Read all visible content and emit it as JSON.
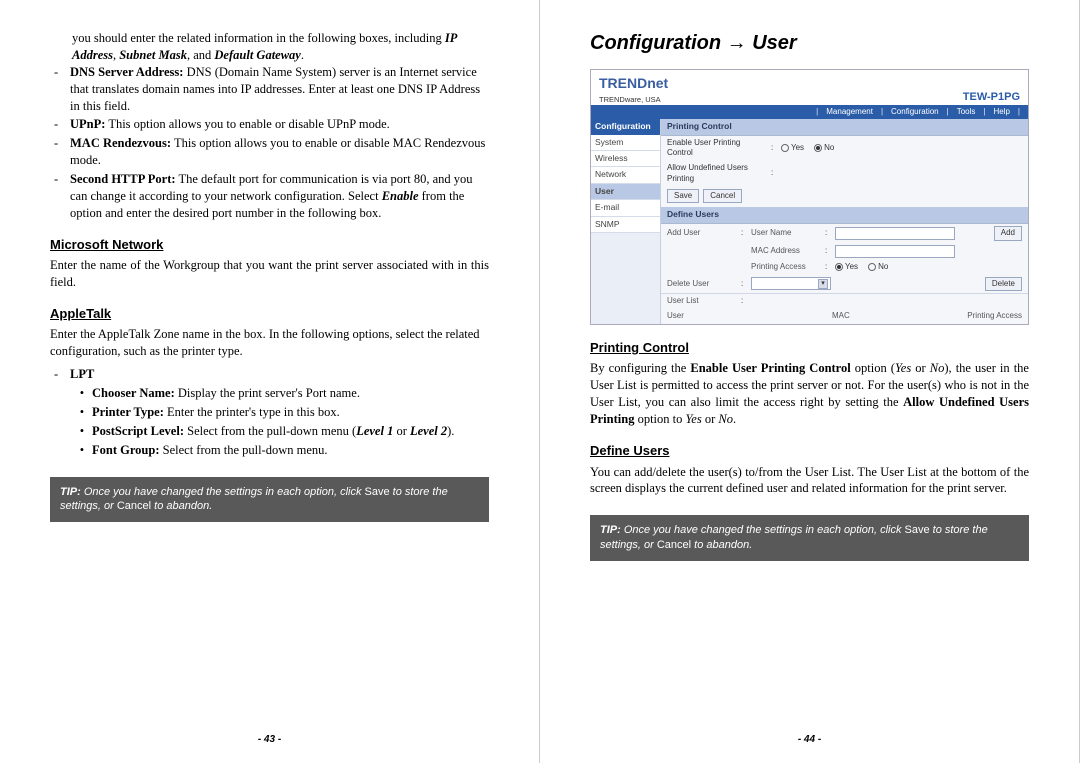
{
  "left": {
    "para_intro": "you should enter the related information in the following boxes, including ",
    "ip": "IP Address",
    "subnet": "Subnet Mask",
    "and": ", and ",
    "gateway": "Default Gateway",
    "dns_label": "DNS Server Address:",
    "dns_text": " DNS (Domain Name System) server is an Internet service that translates domain names into IP addresses. Enter at least one DNS IP Address in this field.",
    "upnp_label": "UPnP:",
    "upnp_text": " This option allows you to enable or disable UPnP mode.",
    "mac_label": "MAC Rendezvous:",
    "mac_text": " This option allows you to enable or disable MAC Rendezvous mode.",
    "http_label": "Second HTTP Port:",
    "http_text1": " The default port for communication is via port 80, and you can change it according to your network configuration.   Select ",
    "http_enable": "Enable",
    "http_text2": " from the option and enter the desired port number in the following box.",
    "sec_ms": "Microsoft Network",
    "ms_para": "Enter the name of the Workgroup that you want the print server associated with in this field.",
    "sec_at": "AppleTalk",
    "at_para": "Enter the AppleTalk Zone name in the box.   In the following options, select the related configuration, such as the printer type.",
    "lpt": "LPT",
    "chooser_label": "Chooser Name:",
    "chooser_text": " Display the print server's Port name.",
    "ptype_label": "Printer Type:",
    "ptype_text": " Enter the printer's type in this box.",
    "ps_label": "PostScript Level:",
    "ps_text1": " Select from the pull-down menu (",
    "ps_l1": "Level 1",
    "ps_or": " or ",
    "ps_l2": "Level 2",
    "ps_text2": ").",
    "font_label": "Font Group:",
    "font_text": " Select from the pull-down menu.",
    "tip_pre": "TIP:",
    "tip_mid": " Once you have changed the settings in each option, click ",
    "tip_save": "Save",
    "tip_mid2": " to store the settings, or ",
    "tip_cancel": "Cancel",
    "tip_end": " to abandon.",
    "pagenum": "- 43 -"
  },
  "right": {
    "title_a": "Configuration ",
    "title_b": " User",
    "sec_pc": "Printing Control",
    "pc_p1a": "By configuring the ",
    "pc_p1_enable": "Enable User Printing Control",
    "pc_p1b": " option (",
    "yes": "Yes",
    "or": " or ",
    "no": "No",
    "pc_p1c": "), the user in the User List is permitted to access the print server or not.   For the user(s) who is not in the User List, you can also limit the access right by setting the ",
    "pc_allow": "Allow Undefined Users Printing",
    "pc_p1d": " option to ",
    "pc_p1e": ".",
    "sec_du": "Define Users",
    "du_para": "You can add/delete the user(s) to/from the User List.   The User List at the bottom of the screen displays the current defined user and related information for the print server.",
    "pagenum": "- 44 -",
    "ui": {
      "logo": "TRENDnet",
      "logo_sub": "TRENDware, USA",
      "model": "TEW-P1PG",
      "menu": [
        "Management",
        "Configuration",
        "Tools",
        "Help"
      ],
      "side_head": "Configuration",
      "side": [
        "System",
        "Wireless",
        "Network",
        "User",
        "E-mail",
        "SNMP"
      ],
      "sec1": "Printing Control",
      "r_enable": "Enable User Printing Control",
      "r_allow": "Allow Undefined Users Printing",
      "opt_yes": "Yes",
      "opt_no": "No",
      "btn_save": "Save",
      "btn_cancel": "Cancel",
      "sec2": "Define Users",
      "add_user": "Add User",
      "user_name": "User Name",
      "mac_addr": "MAC Address",
      "print_acc": "Printing Access",
      "btn_add": "Add",
      "del_user": "Delete User",
      "btn_del": "Delete",
      "user_list": "User List",
      "col_user": "User",
      "col_mac": "MAC",
      "col_pa": "Printing Access"
    }
  }
}
